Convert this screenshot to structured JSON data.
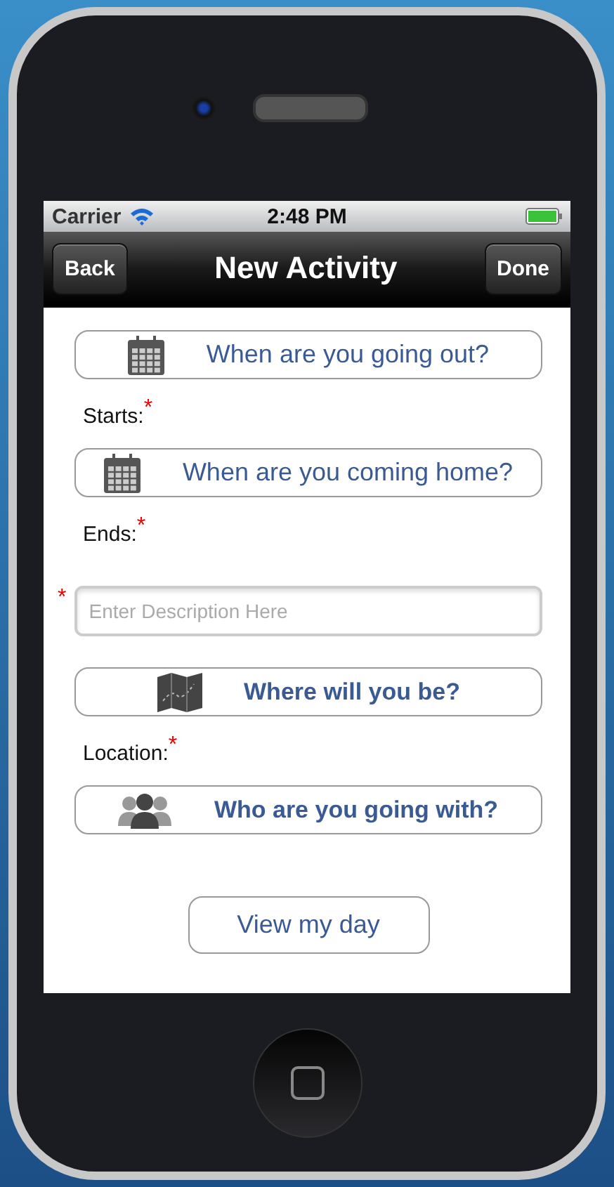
{
  "status_bar": {
    "carrier": "Carrier",
    "time": "2:48 PM"
  },
  "nav_bar": {
    "back": "Back",
    "title": "New Activity",
    "done": "Done"
  },
  "form": [
    {
      "kind": "date-picker",
      "label": "When are you going out?"
    },
    {
      "kind": "label",
      "text": "Starts:",
      "mark": "*"
    },
    {
      "kind": "date-picker",
      "label": "When are you coming home?"
    },
    {
      "kind": "label",
      "text": "Ends:",
      "mark": "*"
    },
    {
      "kind": "text-field",
      "placeholder": "Enter Description Here",
      "mark": "*"
    },
    {
      "kind": "location-picker",
      "label": "Where will you be?"
    },
    {
      "kind": "label",
      "text": "Location:",
      "mark": "*"
    },
    {
      "kind": "people-picker",
      "label": "Who are you going with?"
    },
    {
      "kind": "action",
      "label": "View my day"
    }
  ]
}
